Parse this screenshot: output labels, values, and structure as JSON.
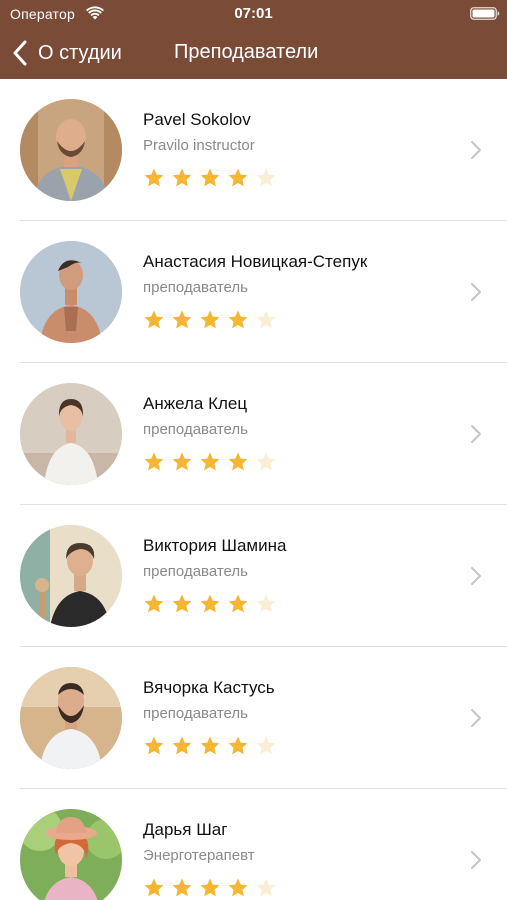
{
  "status_bar": {
    "carrier": "Оператор",
    "time": "07:01"
  },
  "nav": {
    "back_label": "О студии",
    "title": "Преподаватели"
  },
  "colors": {
    "header": "#7a4b37",
    "star_filled": "#f5b731",
    "star_empty": "#fbeed6",
    "divider": "#e6e2de"
  },
  "teachers": [
    {
      "name": "Pavel Sokolov",
      "role": "Pravilo instructor",
      "rating": 4,
      "max_rating": 5
    },
    {
      "name": "Анастасия Новицкая-Степук",
      "role": "преподаватель",
      "rating": 4,
      "max_rating": 5
    },
    {
      "name": "Анжела Клец",
      "role": "преподаватель",
      "rating": 4,
      "max_rating": 5
    },
    {
      "name": "Виктория Шамина",
      "role": "преподаватель",
      "rating": 4,
      "max_rating": 5
    },
    {
      "name": "Вячорка Кастусь",
      "role": "преподаватель",
      "rating": 4,
      "max_rating": 5
    },
    {
      "name": "Дарья Шаг",
      "role": "Энерготерапевт",
      "rating": 4,
      "max_rating": 5
    }
  ]
}
